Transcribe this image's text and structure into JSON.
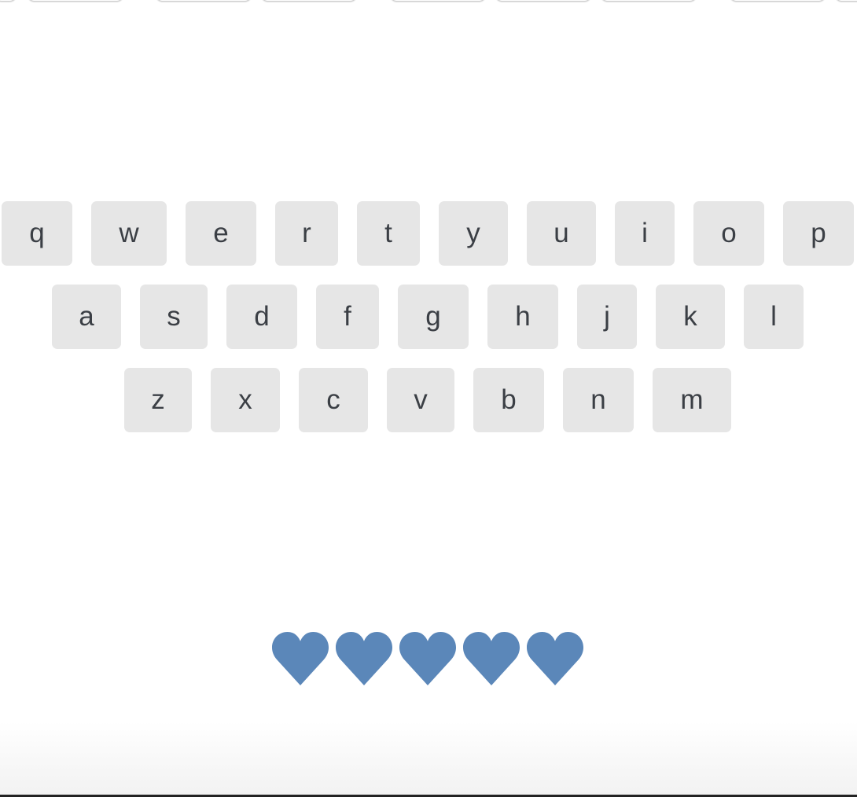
{
  "keyboard": {
    "row1": [
      "q",
      "w",
      "e",
      "r",
      "t",
      "y",
      "u",
      "i",
      "o",
      "p"
    ],
    "row2": [
      "a",
      "s",
      "d",
      "f",
      "g",
      "h",
      "j",
      "k",
      "l"
    ],
    "row3": [
      "z",
      "x",
      "c",
      "v",
      "b",
      "n",
      "m"
    ]
  },
  "lives": {
    "count": 5,
    "icon": "heart-icon",
    "color": "#5b87b9"
  },
  "colors": {
    "key_background": "#e6e6e6",
    "key_text": "#3b3f45",
    "page_background": "#ffffff"
  }
}
